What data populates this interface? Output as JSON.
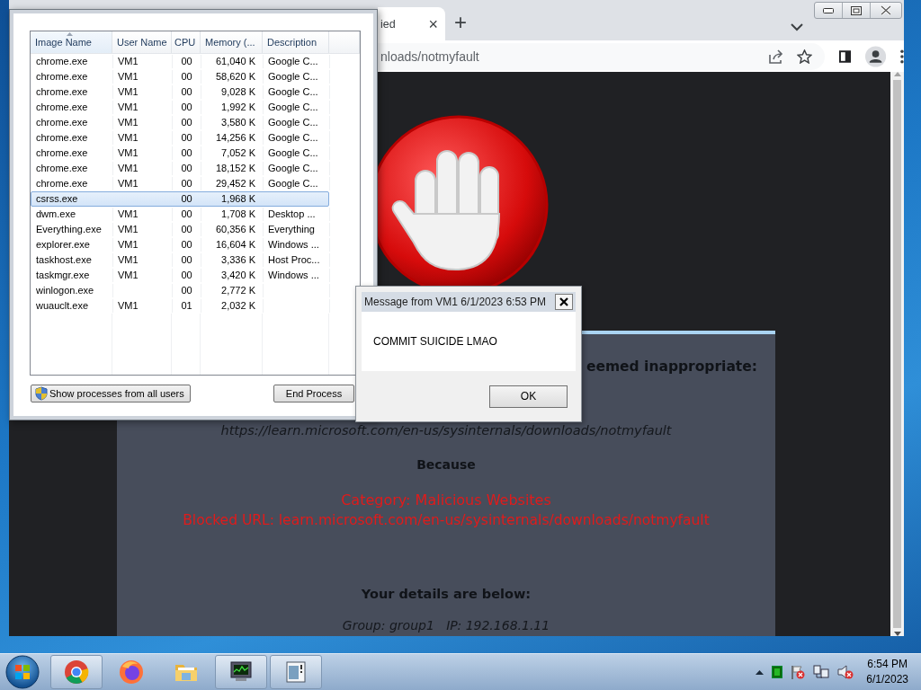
{
  "browser": {
    "tab": {
      "title": "ied",
      "close": "×"
    },
    "new_tab": "+",
    "address": "nloads/notmyfault",
    "page": {
      "heading": "eemed inappropriate:",
      "url": "https://learn.microsoft.com/en-us/sysinternals/downloads/notmyfault",
      "because": "Because",
      "category": "Category: Malicious Websites",
      "blocked_url": "Blocked URL: learn.microsoft.com/en-us/sysinternals/downloads/notmyfault",
      "details_heading": "Your details are below:",
      "details": "Group: group1   IP: 192.168.1.11"
    }
  },
  "task_manager": {
    "columns": [
      {
        "label": "Image Name",
        "sorted": true
      },
      {
        "label": "User Name",
        "sorted": false
      },
      {
        "label": "CPU",
        "sorted": false
      },
      {
        "label": "Memory (...",
        "sorted": false
      },
      {
        "label": "Description",
        "sorted": false
      }
    ],
    "rows": [
      {
        "image": "chrome.exe",
        "user": "VM1",
        "cpu": "00",
        "memory": "61,040 K",
        "description": "Google C...",
        "selected": false
      },
      {
        "image": "chrome.exe",
        "user": "VM1",
        "cpu": "00",
        "memory": "58,620 K",
        "description": "Google C...",
        "selected": false
      },
      {
        "image": "chrome.exe",
        "user": "VM1",
        "cpu": "00",
        "memory": "9,028 K",
        "description": "Google C...",
        "selected": false
      },
      {
        "image": "chrome.exe",
        "user": "VM1",
        "cpu": "00",
        "memory": "1,992 K",
        "description": "Google C...",
        "selected": false
      },
      {
        "image": "chrome.exe",
        "user": "VM1",
        "cpu": "00",
        "memory": "3,580 K",
        "description": "Google C...",
        "selected": false
      },
      {
        "image": "chrome.exe",
        "user": "VM1",
        "cpu": "00",
        "memory": "14,256 K",
        "description": "Google C...",
        "selected": false
      },
      {
        "image": "chrome.exe",
        "user": "VM1",
        "cpu": "00",
        "memory": "7,052 K",
        "description": "Google C...",
        "selected": false
      },
      {
        "image": "chrome.exe",
        "user": "VM1",
        "cpu": "00",
        "memory": "18,152 K",
        "description": "Google C...",
        "selected": false
      },
      {
        "image": "chrome.exe",
        "user": "VM1",
        "cpu": "00",
        "memory": "29,452 K",
        "description": "Google C...",
        "selected": false
      },
      {
        "image": "csrss.exe",
        "cpu": "00",
        "memory": "1,968 K",
        "selected": true
      },
      {
        "image": "dwm.exe",
        "user": "VM1",
        "cpu": "00",
        "memory": "1,708 K",
        "description": "Desktop ...",
        "selected": false
      },
      {
        "image": "Everything.exe",
        "user": "VM1",
        "cpu": "00",
        "memory": "60,356 K",
        "description": "Everything",
        "selected": false
      },
      {
        "image": "explorer.exe",
        "user": "VM1",
        "cpu": "00",
        "memory": "16,604 K",
        "description": "Windows ...",
        "selected": false
      },
      {
        "image": "taskhost.exe",
        "user": "VM1",
        "cpu": "00",
        "memory": "3,336 K",
        "description": "Host Proc...",
        "selected": false
      },
      {
        "image": "taskmgr.exe",
        "user": "VM1",
        "cpu": "00",
        "memory": "3,420 K",
        "description": "Windows ...",
        "selected": false
      },
      {
        "image": "winlogon.exe",
        "cpu": "00",
        "memory": "2,772 K",
        "selected": false
      },
      {
        "image": "wuauclt.exe",
        "user": "VM1",
        "cpu": "01",
        "memory": "2,032 K",
        "selected": false
      }
    ],
    "buttons": [
      {
        "label": "Show processes from all users",
        "kind": "shield"
      },
      {
        "label": "End Process",
        "kind": "plain"
      }
    ]
  },
  "message_dialog": {
    "title": "Message from VM1 6/1/2023 6:53 PM",
    "message": "COMMIT SUICIDE LMAO",
    "button": "OK"
  },
  "taskbar": {
    "items": [
      {
        "kind": "chrome",
        "running": true
      },
      {
        "kind": "firefox",
        "running": false
      },
      {
        "kind": "folder",
        "running": false
      },
      {
        "kind": "taskmgr",
        "running": true
      },
      {
        "kind": "notepad",
        "running": true
      }
    ],
    "clock": {
      "time": "6:54 PM",
      "date": "6/1/2023"
    }
  }
}
